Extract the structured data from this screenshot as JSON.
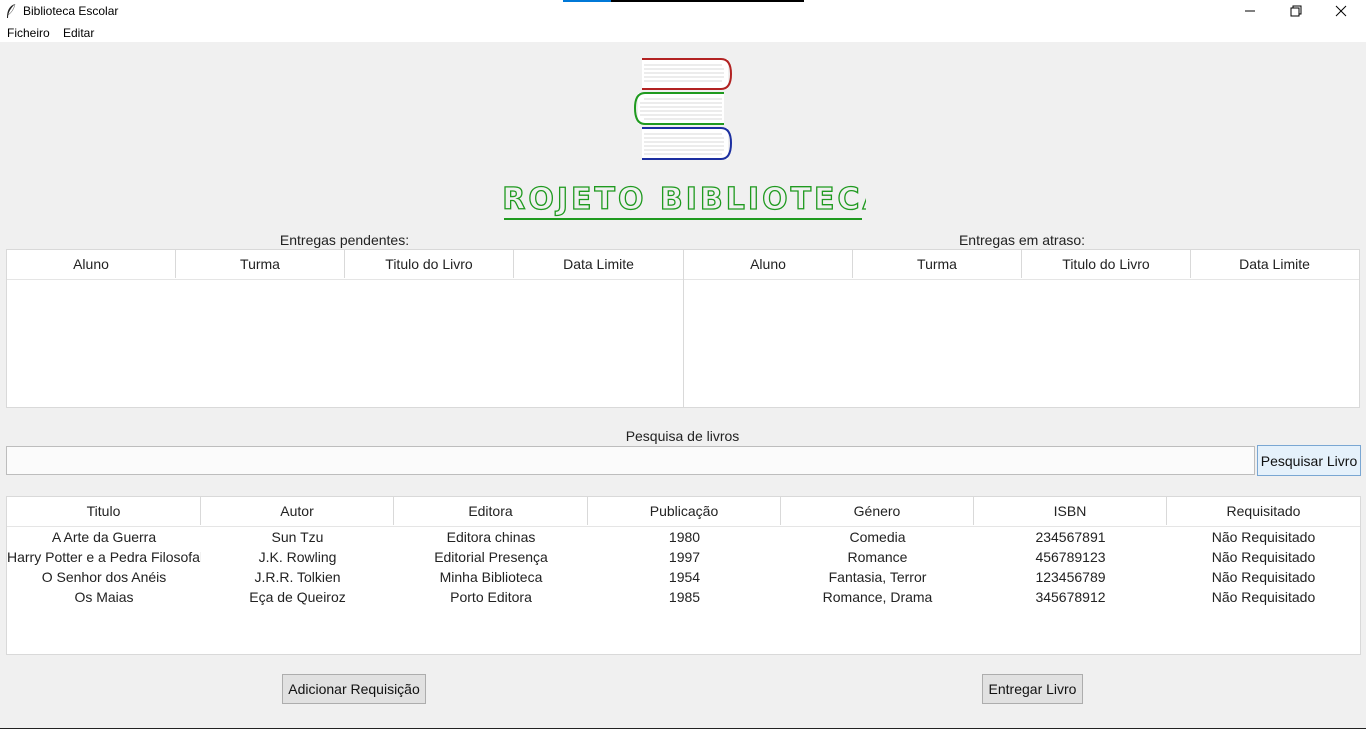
{
  "window": {
    "title": "Biblioteca Escolar",
    "icon": "feather-icon",
    "progress": 0.2
  },
  "menu": [
    "Ficheiro",
    "Editar"
  ],
  "brand": {
    "text": "PROJETO BIBLIOTECA",
    "color": "#1f9a1f",
    "book_colors": [
      "#b22222",
      "#1f9a1f",
      "#1c2fa0"
    ]
  },
  "pending": {
    "label": "Entregas pendentes:",
    "columns": [
      "Aluno",
      "Turma",
      "Titulo do Livro",
      "Data Limite"
    ],
    "rows": []
  },
  "overdue": {
    "label": "Entregas em atraso:",
    "columns": [
      "Aluno",
      "Turma",
      "Titulo do Livro",
      "Data Limite"
    ],
    "rows": []
  },
  "search": {
    "label": "Pesquisa de livros",
    "value": "",
    "placeholder": "",
    "button": "Pesquisar Livro"
  },
  "books": {
    "columns": [
      "Titulo",
      "Autor",
      "Editora",
      "Publicação",
      "Género",
      "ISBN",
      "Requisitado"
    ],
    "rows": [
      [
        "A Arte da Guerra",
        "Sun Tzu",
        "Editora chinas",
        "1980",
        "Comedia",
        "234567891",
        "Não Requisitado"
      ],
      [
        "Harry Potter e a Pedra Filosofal",
        "J.K. Rowling",
        "Editorial Presença",
        "1997",
        "Romance",
        "456789123",
        "Não Requisitado"
      ],
      [
        "O Senhor dos Anéis",
        "J.R.R. Tolkien",
        "Minha Biblioteca",
        "1954",
        "Fantasia, Terror",
        "123456789",
        "Não Requisitado"
      ],
      [
        "Os Maias",
        "Eça de Queiroz",
        "Porto Editora",
        "1985",
        "Romance, Drama",
        "345678912",
        "Não Requisitado"
      ]
    ]
  },
  "actions": {
    "add": "Adicionar Requisição",
    "deliver": "Entregar Livro"
  }
}
